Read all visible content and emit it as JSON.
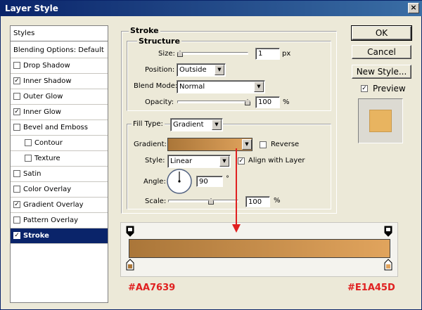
{
  "window": {
    "title": "Layer Style",
    "close_label": "×"
  },
  "left_panel": {
    "items": [
      {
        "label": "Styles",
        "checkbox": false
      },
      {
        "label": "Blending Options: Default",
        "checkbox": false
      },
      {
        "label": "Drop Shadow",
        "checkbox": true,
        "checked": false
      },
      {
        "label": "Inner Shadow",
        "checkbox": true,
        "checked": true
      },
      {
        "label": "Outer Glow",
        "checkbox": true,
        "checked": false
      },
      {
        "label": "Inner Glow",
        "checkbox": true,
        "checked": true
      },
      {
        "label": "Bevel and Emboss",
        "checkbox": true,
        "checked": false
      },
      {
        "label": "Contour",
        "checkbox": true,
        "checked": false
      },
      {
        "label": "Texture",
        "checkbox": true,
        "checked": false
      },
      {
        "label": "Satin",
        "checkbox": true,
        "checked": false
      },
      {
        "label": "Color Overlay",
        "checkbox": true,
        "checked": false
      },
      {
        "label": "Gradient Overlay",
        "checkbox": true,
        "checked": true
      },
      {
        "label": "Pattern Overlay",
        "checkbox": true,
        "checked": false
      },
      {
        "label": "Stroke",
        "checkbox": true,
        "checked": true,
        "selected": true
      }
    ],
    "check_glyph": "✓"
  },
  "stroke": {
    "section_title": "Stroke",
    "structure_title": "Structure",
    "size_label": "Size:",
    "size_value": "1",
    "size_unit": "px",
    "size_level": 0.0,
    "position_label": "Position:",
    "position_value": "Outside",
    "blend_label": "Blend Mode:",
    "blend_value": "Normal",
    "opacity_label": "Opacity:",
    "opacity_value": "100",
    "opacity_unit": "%",
    "opacity_level": 1.0,
    "fill_type_label": "Fill Type:",
    "fill_type_value": "Gradient",
    "gradient_label": "Gradient:",
    "reverse_label": "Reverse",
    "style_label": "Style:",
    "style_value": "Linear",
    "align_label": "Align with Layer",
    "angle_label": "Angle:",
    "angle_value": "90",
    "angle_unit": "°",
    "scale_label": "Scale:",
    "scale_value": "100",
    "scale_unit": "%",
    "scale_level": 0.62
  },
  "buttons": {
    "ok": "OK",
    "cancel": "Cancel",
    "new_style": "New Style...",
    "preview_label": "Preview"
  },
  "annotation": {
    "left_color": "#AA7639",
    "right_color": "#E1A45D",
    "label_color": "#e02020",
    "arrow_color": "#e02020"
  },
  "colors": {
    "gradient_start": "#AA7639",
    "gradient_end": "#E1A45D",
    "preview_swatch": "#E8B460",
    "selection": "#0a246a"
  }
}
